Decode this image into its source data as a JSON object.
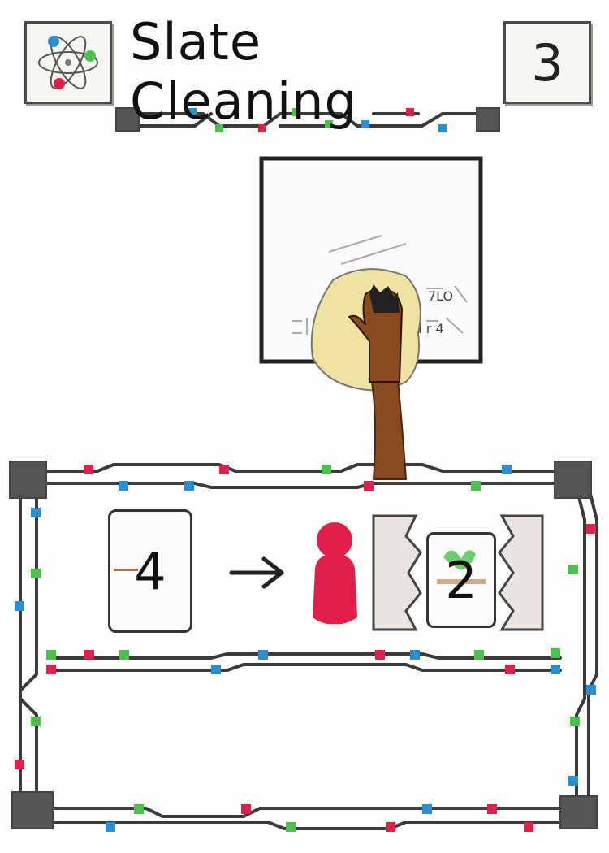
{
  "card": {
    "title": "Slate Cleaning",
    "cost": "3",
    "category_icon": "atom-icon"
  },
  "effect": {
    "discard_card_value": "4",
    "arrow_icon": "arrow-right-icon",
    "player_icon": "player-meeple-icon",
    "gain_card_value": "2"
  },
  "colors": {
    "red": "#e0204a",
    "blue": "#2a8fd0",
    "green": "#4cc04c",
    "dark": "#333333",
    "skin": "#8a4a1f",
    "cloth": "#eee3a0"
  }
}
